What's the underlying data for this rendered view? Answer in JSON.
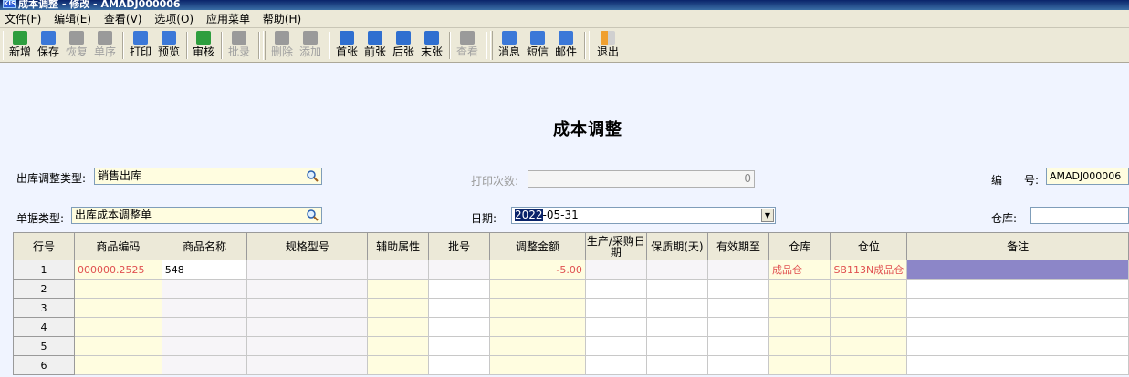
{
  "window": {
    "app_icon": "KIS",
    "title": "成本调整 - 修改 - AMADJ000006"
  },
  "menu": [
    "文件(F)",
    "编辑(E)",
    "查看(V)",
    "选项(O)",
    "应用菜单",
    "帮助(H)"
  ],
  "toolbar": {
    "new": "新增",
    "save": "保存",
    "restore": "恢复",
    "detail": "单序",
    "print": "打印",
    "preview": "预览",
    "audit": "审核",
    "batch": "批录",
    "delete": "删除",
    "add": "添加",
    "first": "首张",
    "prev": "前张",
    "next": "后张",
    "last": "末张",
    "view": "查看",
    "message": "消息",
    "sms": "短信",
    "mail": "邮件",
    "exit": "退出"
  },
  "form": {
    "title": "成本调整",
    "outbound_type_label": "出库调整类型:",
    "outbound_type_value": "销售出库",
    "print_count_label": "打印次数:",
    "print_count_value": "0",
    "number_label": "编　　号:",
    "number_value": "AMADJ000006",
    "doc_type_label": "单据类型:",
    "doc_type_value": "出库成本调整单",
    "date_label": "日期:",
    "date_year": "2022",
    "date_rest": "-05-31",
    "warehouse_label": "仓库:",
    "warehouse_value": ""
  },
  "grid": {
    "headers": [
      "行号",
      "商品编码",
      "商品名称",
      "规格型号",
      "辅助属性",
      "批号",
      "调整金额",
      "生产/采购日期",
      "保质期(天)",
      "有效期至",
      "仓库",
      "仓位",
      "备注"
    ],
    "rows": [
      {
        "no": "1",
        "code": "000000.2525",
        "name": "548",
        "spec": "",
        "aux": "",
        "batch": "",
        "amount": "-5.00",
        "mfg": "",
        "shelf": "",
        "expiry": "",
        "warehouse": "成品仓",
        "location": "SB113N成品仓",
        "remark": ""
      },
      {
        "no": "2",
        "code": "",
        "name": "",
        "spec": "",
        "aux": "",
        "batch": "",
        "amount": "",
        "mfg": "",
        "shelf": "",
        "expiry": "",
        "warehouse": "",
        "location": "",
        "remark": ""
      },
      {
        "no": "3",
        "code": "",
        "name": "",
        "spec": "",
        "aux": "",
        "batch": "",
        "amount": "",
        "mfg": "",
        "shelf": "",
        "expiry": "",
        "warehouse": "",
        "location": "",
        "remark": ""
      },
      {
        "no": "4",
        "code": "",
        "name": "",
        "spec": "",
        "aux": "",
        "batch": "",
        "amount": "",
        "mfg": "",
        "shelf": "",
        "expiry": "",
        "warehouse": "",
        "location": "",
        "remark": ""
      },
      {
        "no": "5",
        "code": "",
        "name": "",
        "spec": "",
        "aux": "",
        "batch": "",
        "amount": "",
        "mfg": "",
        "shelf": "",
        "expiry": "",
        "warehouse": "",
        "location": "",
        "remark": ""
      },
      {
        "no": "6",
        "code": "",
        "name": "",
        "spec": "",
        "aux": "",
        "batch": "",
        "amount": "",
        "mfg": "",
        "shelf": "",
        "expiry": "",
        "warehouse": "",
        "location": "",
        "remark": ""
      }
    ]
  },
  "colors": {
    "titlebar": "#0a246a",
    "field_bg": "#fffde0",
    "grid_red": "#e05050",
    "selection": "#8c86c8"
  }
}
